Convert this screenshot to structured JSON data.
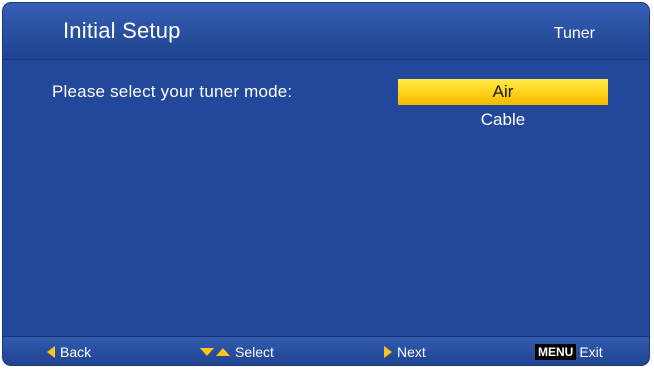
{
  "header": {
    "title": "Initial Setup",
    "section": "Tuner"
  },
  "main": {
    "prompt": "Please select your tuner mode:",
    "options": [
      {
        "label": "Air",
        "selected": true
      },
      {
        "label": "Cable",
        "selected": false
      }
    ]
  },
  "footer": {
    "back_label": "Back",
    "select_label": "Select",
    "next_label": "Next",
    "menu_key": "MENU",
    "exit_label": "Exit"
  },
  "colors": {
    "background": "#23479a",
    "highlight": "#ffd41a",
    "arrow": "#ffc31a"
  },
  "icons": [
    "arrow-left-icon",
    "arrow-down-icon",
    "arrow-up-icon",
    "arrow-right-icon"
  ]
}
